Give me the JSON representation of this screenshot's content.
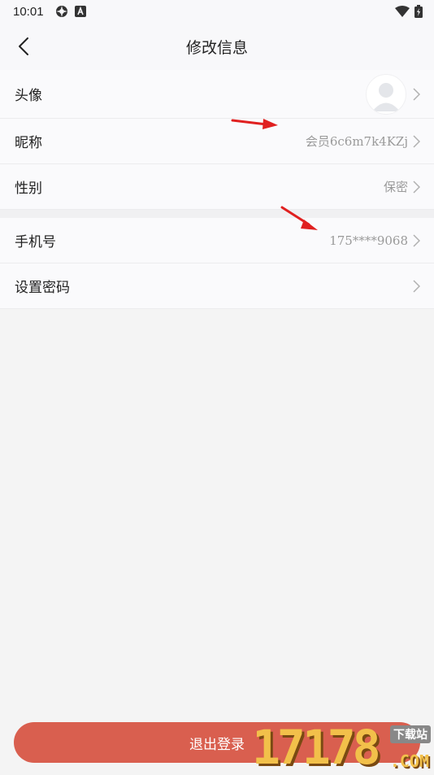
{
  "status_bar": {
    "time": "10:01",
    "icons_left": [
      "settings-gear-icon",
      "a-notification-icon"
    ],
    "icons_right": [
      "wifi-icon",
      "battery-icon"
    ]
  },
  "header": {
    "title": "修改信息",
    "back_icon": "chevron-left-icon"
  },
  "profile": {
    "rows": [
      {
        "label": "头像",
        "value": ""
      },
      {
        "label": "昵称",
        "value": "会员6c6m7k4KZj"
      },
      {
        "label": "性别",
        "value": "保密"
      }
    ]
  },
  "account": {
    "rows": [
      {
        "label": "手机号",
        "value": "175****9068"
      },
      {
        "label": "设置密码",
        "value": ""
      }
    ]
  },
  "logout_button": {
    "label": "退出登录"
  },
  "watermark": {
    "digits": "17178",
    "tag": "下载站",
    "suffix": ".COM"
  },
  "colors": {
    "accent": "#d95f4f",
    "annotation_arrow": "#e02020",
    "value_text": "#9a9a9a"
  }
}
